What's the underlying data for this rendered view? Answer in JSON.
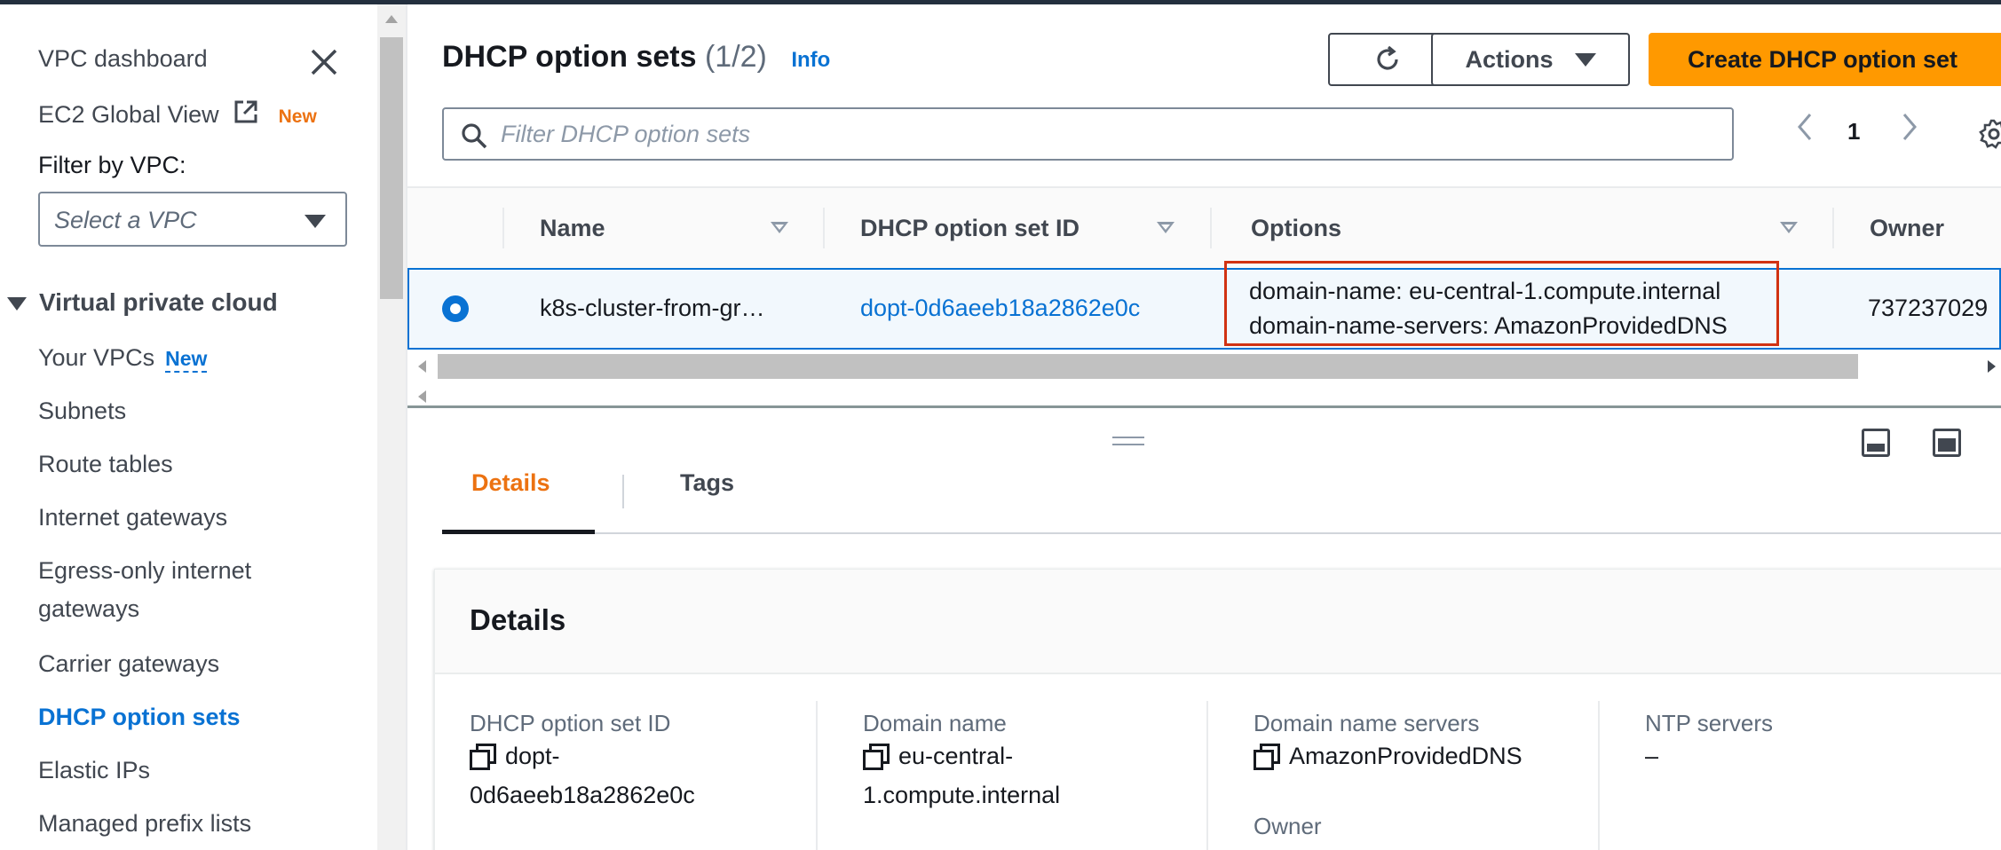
{
  "sidebar": {
    "dashboard": "VPC dashboard",
    "global_view": "EC2 Global View",
    "global_view_badge": "New",
    "filter_label": "Filter by VPC:",
    "vpc_select_placeholder": "Select a VPC",
    "section_title": "Virtual private cloud",
    "your_vpcs": "Your VPCs",
    "your_vpcs_badge": "New",
    "items": [
      "Subnets",
      "Route tables",
      "Internet gateways",
      "Egress-only internet",
      "gateways",
      "Carrier gateways",
      "DHCP option sets",
      "Elastic IPs",
      "Managed prefix lists"
    ]
  },
  "header": {
    "title": "DHCP option sets",
    "count": "(1/2)",
    "info": "Info",
    "actions_label": "Actions",
    "create_label": "Create DHCP option set"
  },
  "filter": {
    "placeholder": "Filter DHCP option sets"
  },
  "pagination": {
    "prev": "‹",
    "page": "1",
    "next": "›"
  },
  "table": {
    "columns": [
      "Name",
      "DHCP option set ID",
      "Options",
      "Owner"
    ],
    "rows": [
      {
        "name": "k8s-cluster-from-gr…",
        "id": "dopt-0d6aeeb18a2862e0c",
        "option1": "domain-name: eu-central-1.compute.internal",
        "option2": "domain-name-servers: AmazonProvidedDNS",
        "owner": "737237029"
      }
    ]
  },
  "tabs": [
    "Details",
    "Tags"
  ],
  "details": {
    "title": "Details",
    "id_label": "DHCP option set ID",
    "id_value_1": "dopt-",
    "id_value_2": "0d6aeeb18a2862e0c",
    "domain_label": "Domain name",
    "domain_value_1": "eu-central-",
    "domain_value_2": "1.compute.internal",
    "dns_label": "Domain name servers",
    "dns_value": "AmazonProvidedDNS",
    "ntp_label": "NTP servers",
    "ntp_value": "–",
    "owner_label": "Owner"
  },
  "colors": {
    "accent": "#0972d3",
    "primary_button": "#ff9900",
    "active_tab": "#ec7211",
    "highlight_box": "#d13212"
  }
}
